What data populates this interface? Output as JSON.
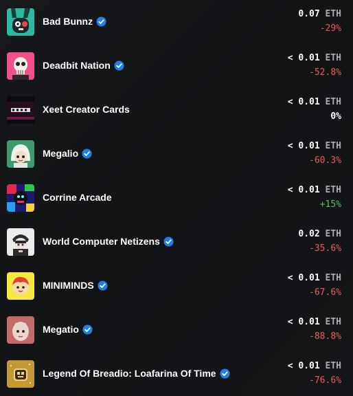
{
  "collections": [
    {
      "name": "Bad Bunnz",
      "verified": true,
      "price": "0.07",
      "unit": "ETH",
      "change": "-29%",
      "trend": "neg"
    },
    {
      "name": "Deadbit Nation",
      "verified": true,
      "price": "< 0.01",
      "unit": "ETH",
      "change": "-52.8%",
      "trend": "neg"
    },
    {
      "name": "Xeet Creator Cards",
      "verified": false,
      "price": "< 0.01",
      "unit": "ETH",
      "change": "0%",
      "trend": "flat"
    },
    {
      "name": "Megalio",
      "verified": true,
      "price": "< 0.01",
      "unit": "ETH",
      "change": "-60.3%",
      "trend": "neg"
    },
    {
      "name": "Corrine Arcade",
      "verified": false,
      "price": "< 0.01",
      "unit": "ETH",
      "change": "+15%",
      "trend": "pos"
    },
    {
      "name": "World Computer Netizens",
      "verified": true,
      "price": "0.02",
      "unit": "ETH",
      "change": "-35.6%",
      "trend": "neg"
    },
    {
      "name": "MINIMINDS",
      "verified": true,
      "price": "< 0.01",
      "unit": "ETH",
      "change": "-67.6%",
      "trend": "neg"
    },
    {
      "name": "Megatio",
      "verified": true,
      "price": "< 0.01",
      "unit": "ETH",
      "change": "-88.8%",
      "trend": "neg"
    },
    {
      "name": "Legend Of Breadio: Loafarina Of Time",
      "verified": true,
      "price": "< 0.01",
      "unit": "ETH",
      "change": "-76.6%",
      "trend": "neg"
    }
  ],
  "colors": {
    "negative": "#ef5a5a",
    "positive": "#4cc567",
    "verified": "#2081e2",
    "unit": "#a8abb0"
  }
}
